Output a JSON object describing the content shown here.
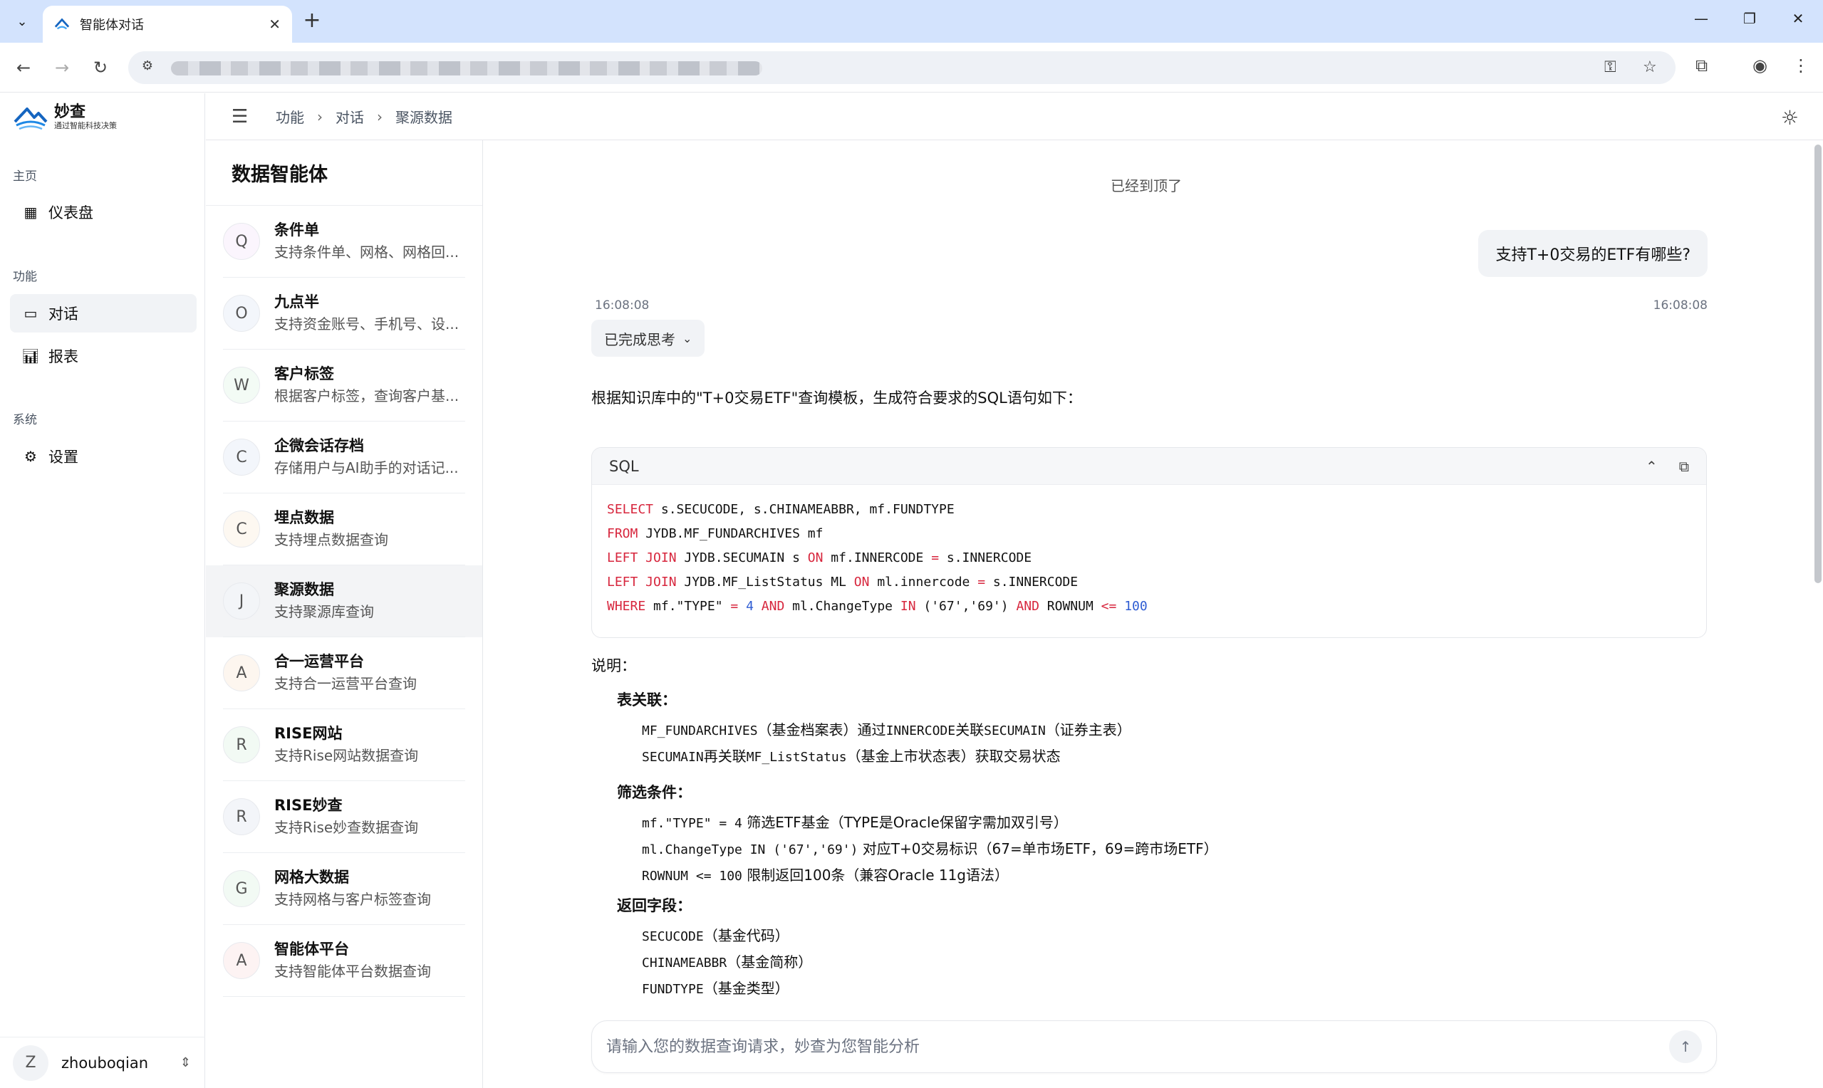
{
  "browser": {
    "tab_title": "智能体对话",
    "new_tab": "+"
  },
  "app": {
    "logo_name": "妙查",
    "logo_slogan": "通过智能科技决策",
    "sections": {
      "home": "主页",
      "features": "功能",
      "system": "系统"
    },
    "nav": {
      "dashboard": "仪表盘",
      "chat": "对话",
      "reports": "报表",
      "settings": "设置"
    },
    "user": {
      "initial": "Z",
      "name": "zhouboqian"
    },
    "breadcrumb": [
      "功能",
      "对话",
      "聚源数据"
    ]
  },
  "agents": {
    "title": "数据智能体",
    "items": [
      {
        "initial": "Q",
        "name": "条件单",
        "desc": "支持条件单、网格、网格回...",
        "color": "#fbf5fd"
      },
      {
        "initial": "O",
        "name": "九点半",
        "desc": "支持资金账号、手机号、设...",
        "color": "#f3f6fb"
      },
      {
        "initial": "W",
        "name": "客户标签",
        "desc": "根据客户标签，查询客户基...",
        "color": "#f3fbf5"
      },
      {
        "initial": "C",
        "name": "企微会话存档",
        "desc": "存储用户与AI助手的对话记...",
        "color": "#f3f6fb"
      },
      {
        "initial": "C",
        "name": "埋点数据",
        "desc": "支持埋点数据查询",
        "color": "#fdf8f1"
      },
      {
        "initial": "J",
        "name": "聚源数据",
        "desc": "支持聚源库查询",
        "color": "#f3f5f8"
      },
      {
        "initial": "A",
        "name": "合一运营平台",
        "desc": "支持合一运营平台查询",
        "color": "#fdf6ef"
      },
      {
        "initial": "R",
        "name": "RISE网站",
        "desc": "支持Rise网站数据查询",
        "color": "#f2faf4"
      },
      {
        "initial": "R",
        "name": "RISE妙查",
        "desc": "支持Rise妙查数据查询",
        "color": "#f3f5f9"
      },
      {
        "initial": "G",
        "name": "网格大数据",
        "desc": "支持网格与客户标签查询",
        "color": "#f2faf4"
      },
      {
        "initial": "A",
        "name": "智能体平台",
        "desc": "支持智能体平台数据查询",
        "color": "#fdf3f3"
      }
    ]
  },
  "chat": {
    "top_notice": "已经到顶了",
    "user_time": "16:08:08",
    "user_message": "支持T+0交易的ETF有哪些?",
    "bot_time": "16:08:08",
    "thinking_label": "已完成思考",
    "intro": "根据知识库中的\"T+0交易ETF\"查询模板，生成符合要求的SQL语句如下：",
    "code_lang": "SQL",
    "explain_title": "说明：",
    "table_join_title": "表关联：",
    "table_join": [
      [
        "MF_FUNDARCHIVES",
        "（基金档案表）通过",
        "INNERCODE",
        "关联",
        "SECUMAIN",
        "（证券主表）"
      ],
      [
        "SECUMAIN",
        "再关联",
        "MF_ListStatus",
        "（基金上市状态表）获取交易状态"
      ]
    ],
    "filter_title": "筛选条件：",
    "filters": [
      {
        "code": "mf.\"TYPE\" = 4",
        "text": " 筛选ETF基金（TYPE是Oracle保留字需加双引号）"
      },
      {
        "code": "ml.ChangeType IN ('67','69')",
        "text": " 对应T+0交易标识（67=单市场ETF，69=跨市场ETF）"
      },
      {
        "code": "ROWNUM <= 100",
        "text": " 限制返回100条（兼容Oracle 11g语法）"
      }
    ],
    "fields_title": "返回字段：",
    "fields": [
      {
        "code": "SECUCODE",
        "text": "（基金代码）"
      },
      {
        "code": "CHINAMEABBR",
        "text": "（基金简称）"
      },
      {
        "code": "FUNDTYPE",
        "text": "（基金类型）"
      }
    ],
    "input_placeholder": "请输入您的数据查询请求，妙查为您智能分析"
  }
}
